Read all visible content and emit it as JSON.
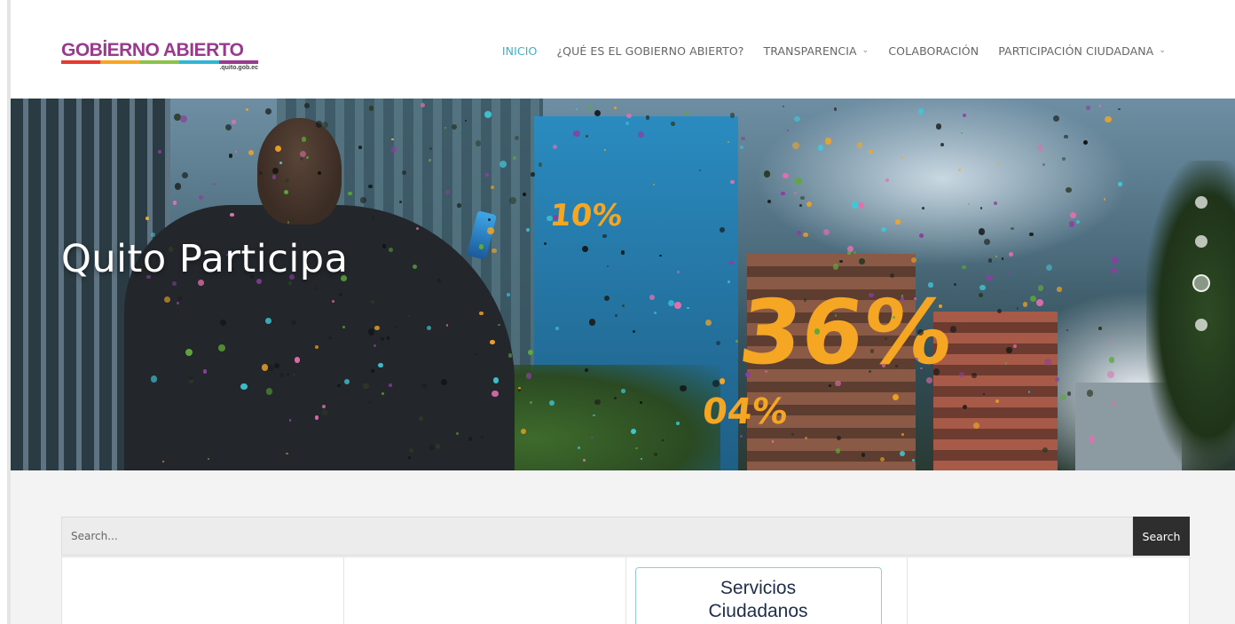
{
  "header": {
    "logo_text": "GOBİERNO ABIERTO",
    "logo_sub": ".quito.gob.ec",
    "logo_bar_colors": [
      "#e63a2e",
      "#f6a623",
      "#8bc34a",
      "#2fb6d2",
      "#9a3a8f"
    ],
    "nav": [
      {
        "label": "INICIO",
        "active": true,
        "has_dropdown": false
      },
      {
        "label": "¿QUÉ ES EL GOBIERNO ABIERTO?",
        "active": false,
        "has_dropdown": false
      },
      {
        "label": "TRANSPARENCIA",
        "active": false,
        "has_dropdown": true
      },
      {
        "label": "COLABORACIÓN",
        "active": false,
        "has_dropdown": false
      },
      {
        "label": "PARTICIPACIÓN CIUDADANA",
        "active": false,
        "has_dropdown": true
      }
    ],
    "accent_color": "#2fb6d2"
  },
  "hero": {
    "title": "Quito Participa",
    "overlay_numbers": {
      "n1": "10%",
      "n2": "36%",
      "n3": "04%"
    },
    "slider_count": 4,
    "slider_active_index": 2
  },
  "search": {
    "placeholder": "Search...",
    "button_label": "Search"
  },
  "cards": {
    "services_line1": "Servicios",
    "services_line2": "Ciudadanos"
  },
  "icons": {
    "dropdown": "chevron-down-icon"
  }
}
